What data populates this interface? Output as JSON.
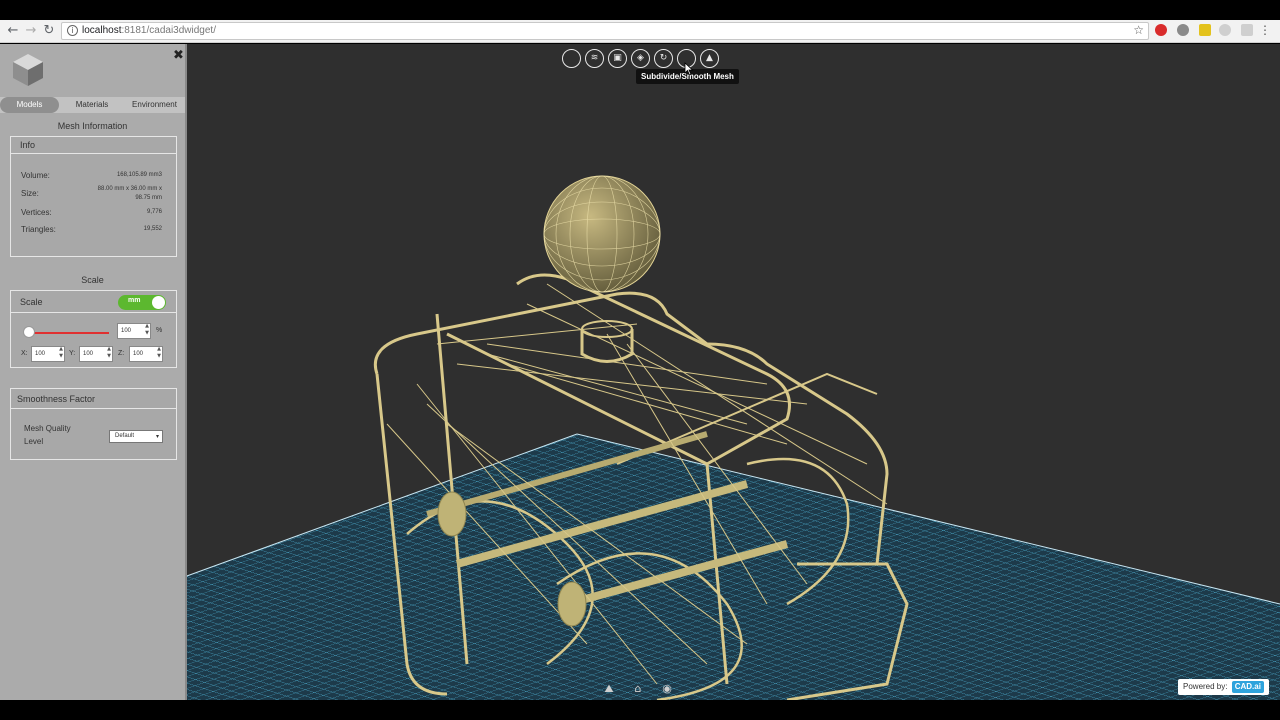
{
  "browser": {
    "url_host": "localhost",
    "url_path": ":8181/cadai3dwidget/",
    "back_icon": "arrow-left",
    "forward_icon": "arrow-right",
    "reload_icon": "reload",
    "star_icon": "star"
  },
  "sidebar": {
    "tabs": [
      {
        "label": "Models",
        "active": true
      },
      {
        "label": "Materials",
        "active": false
      },
      {
        "label": "Environment",
        "active": false
      }
    ],
    "mesh_section_title": "Mesh Information",
    "info": {
      "title": "Info",
      "rows": [
        {
          "label": "Volume:",
          "value": "168,105.89 mm3"
        },
        {
          "label": "Size:",
          "value_line1": "88.00 mm x 36.00 mm x",
          "value_line2": "98.75 mm"
        },
        {
          "label": "Vertices:",
          "value": "9,776"
        },
        {
          "label": "Triangles:",
          "value": "19,552"
        }
      ]
    },
    "scale_section_title": "Scale",
    "scale": {
      "title": "Scale",
      "unit_toggle": "mm",
      "percent_value": "100",
      "percent_sign": "%",
      "x_label": "X:",
      "x_value": "100",
      "y_label": "Y:",
      "y_value": "100",
      "z_label": "Z:",
      "z_value": "100",
      "slider_fraction": 0.0
    },
    "smoothness": {
      "title": "Smoothness Factor",
      "label_line1": "Mesh Quality",
      "label_line2": "Level",
      "select_value": "Default"
    }
  },
  "toolbar": {
    "tools": [
      "circle-icon",
      "layers-icon",
      "cube-icon",
      "box-3d-icon",
      "rotate-icon",
      "smooth-circle-icon",
      "mesh-icon"
    ],
    "tooltip": "Subdivide/Smooth Mesh"
  },
  "footer": {
    "powered_by": "Powered by:",
    "brand": "CAD.ai",
    "bottom_icons": [
      "landscape-icon",
      "vr-icon",
      "camera-icon"
    ]
  },
  "colors": {
    "sidebar_bg": "#ababab",
    "viewport_bg": "#2f2f2f",
    "grid": "#4fb3d6",
    "mesh": "#d8c88a",
    "toggle_on": "#5cb82f",
    "slider": "#e03030"
  }
}
